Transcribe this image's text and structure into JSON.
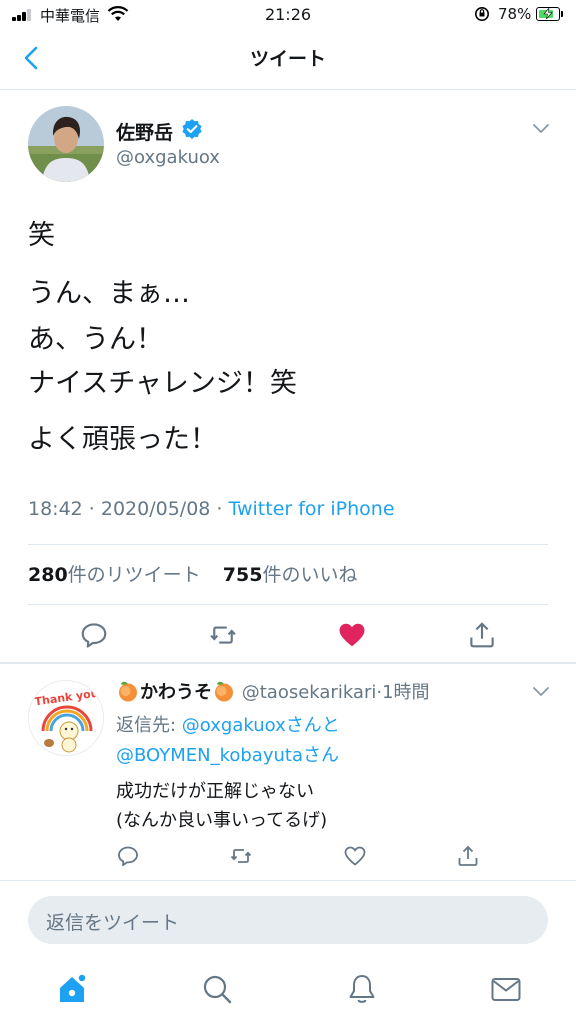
{
  "status_bar": {
    "carrier": "中華電信",
    "time": "21:26",
    "battery_percent": "78%",
    "battery_level": 0.78,
    "icons": [
      "signal-icon",
      "wifi-icon",
      "rotation-lock-icon",
      "battery-charging-icon"
    ]
  },
  "nav": {
    "title": "ツイート",
    "back_icon": "chevron-left-icon"
  },
  "tweet": {
    "author_name": "佐野岳",
    "author_handle": "@oxgakuox",
    "lines": [
      "笑",
      "うん、まぁ…",
      "あ、うん！",
      "ナイスチャレンジ！笑",
      "よく頑張った！"
    ],
    "timestamp": "18:42 · 2020/05/08 · ",
    "source": "Twitter for iPhone",
    "retweet_count": "280",
    "retweet_label": "件のリツイート",
    "like_count": "755",
    "like_label": "件のいいね",
    "actions": [
      "reply-icon",
      "retweet-icon",
      "like-icon-filled",
      "share-icon"
    ],
    "like_color": "#e0245e"
  },
  "reply": {
    "author_name": "かわうそ",
    "author_handle": "@taosekarikari",
    "time": "·1時間",
    "to_prefix": "返信先: ",
    "to_user1": "@oxgakuox",
    "to_mid": "さんと",
    "to_user2": "@BOYMEN_kobayuta",
    "to_suffix": "さん",
    "text_lines": [
      "成功だけが正解じゃない",
      "(なんか良い事いってるげ)"
    ],
    "avatar_text": "Thank you",
    "actions": [
      "reply-icon",
      "retweet-icon",
      "like-icon",
      "share-icon"
    ]
  },
  "compose": {
    "placeholder": "返信をツイート"
  },
  "tab_bar": {
    "items": [
      "home-icon",
      "search-icon",
      "notifications-icon",
      "messages-icon"
    ]
  },
  "colors": {
    "accent": "#1da1f2",
    "secondary_text": "#657786",
    "divider": "#e1e8ed"
  }
}
